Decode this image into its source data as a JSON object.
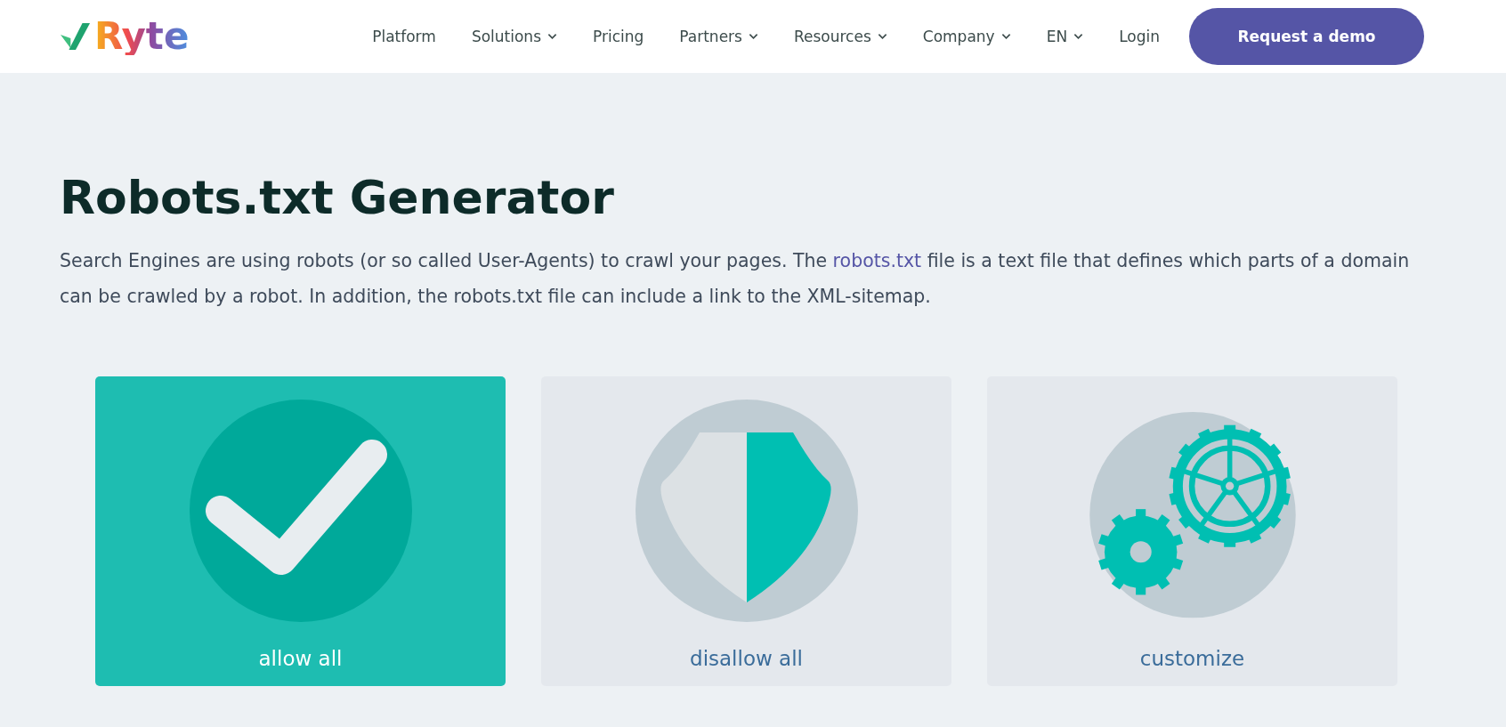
{
  "header": {
    "logo_text": "Ryte",
    "nav": [
      {
        "label": "Platform",
        "dropdown": false
      },
      {
        "label": "Solutions",
        "dropdown": true
      },
      {
        "label": "Pricing",
        "dropdown": false
      },
      {
        "label": "Partners",
        "dropdown": true
      },
      {
        "label": "Resources",
        "dropdown": true
      },
      {
        "label": "Company",
        "dropdown": true
      },
      {
        "label": "EN",
        "dropdown": true
      },
      {
        "label": "Login",
        "dropdown": false
      }
    ],
    "cta": "Request a demo"
  },
  "title": "Robots.txt Generator",
  "intro": {
    "before": "Search Engines are using robots (or so called User-Agents) to crawl your pages. The ",
    "link": "robots.txt",
    "after": " file is a text file that defines which parts of a domain can be crawled by a robot. In addition, the robots.txt file can include a link to the XML-sitemap."
  },
  "options": [
    {
      "kind": "check",
      "label": "allow all",
      "selected": true
    },
    {
      "kind": "shield",
      "label": "disallow all",
      "selected": false
    },
    {
      "kind": "gears",
      "label": "customize",
      "selected": false
    }
  ]
}
